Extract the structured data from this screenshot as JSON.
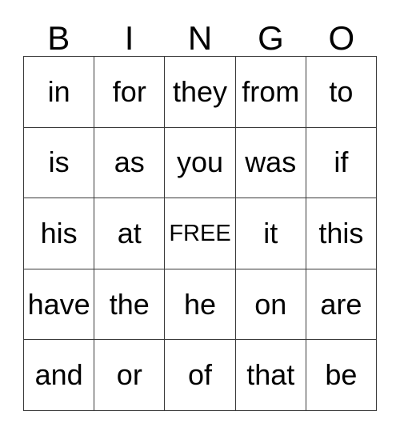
{
  "card": {
    "header": {
      "letters": [
        "B",
        "I",
        "N",
        "G",
        "O"
      ]
    },
    "grid": {
      "rows": 5,
      "columns": 5,
      "free_space": {
        "label": "FREE",
        "row": 2,
        "column": 2
      },
      "cells": [
        [
          {
            "text": "in"
          },
          {
            "text": "for"
          },
          {
            "text": "they"
          },
          {
            "text": "from"
          },
          {
            "text": "to"
          }
        ],
        [
          {
            "text": "is"
          },
          {
            "text": "as"
          },
          {
            "text": "you"
          },
          {
            "text": "was"
          },
          {
            "text": "if"
          }
        ],
        [
          {
            "text": "his"
          },
          {
            "text": "at"
          },
          {
            "text": "FREE"
          },
          {
            "text": "it"
          },
          {
            "text": "this"
          }
        ],
        [
          {
            "text": "have"
          },
          {
            "text": "the"
          },
          {
            "text": "he"
          },
          {
            "text": "on"
          },
          {
            "text": "are"
          }
        ],
        [
          {
            "text": "and"
          },
          {
            "text": "or"
          },
          {
            "text": "of"
          },
          {
            "text": "that"
          },
          {
            "text": "be"
          }
        ]
      ]
    },
    "colors": {
      "background": "#ffffff",
      "text": "#000000",
      "border": "#3a3a3a"
    }
  }
}
